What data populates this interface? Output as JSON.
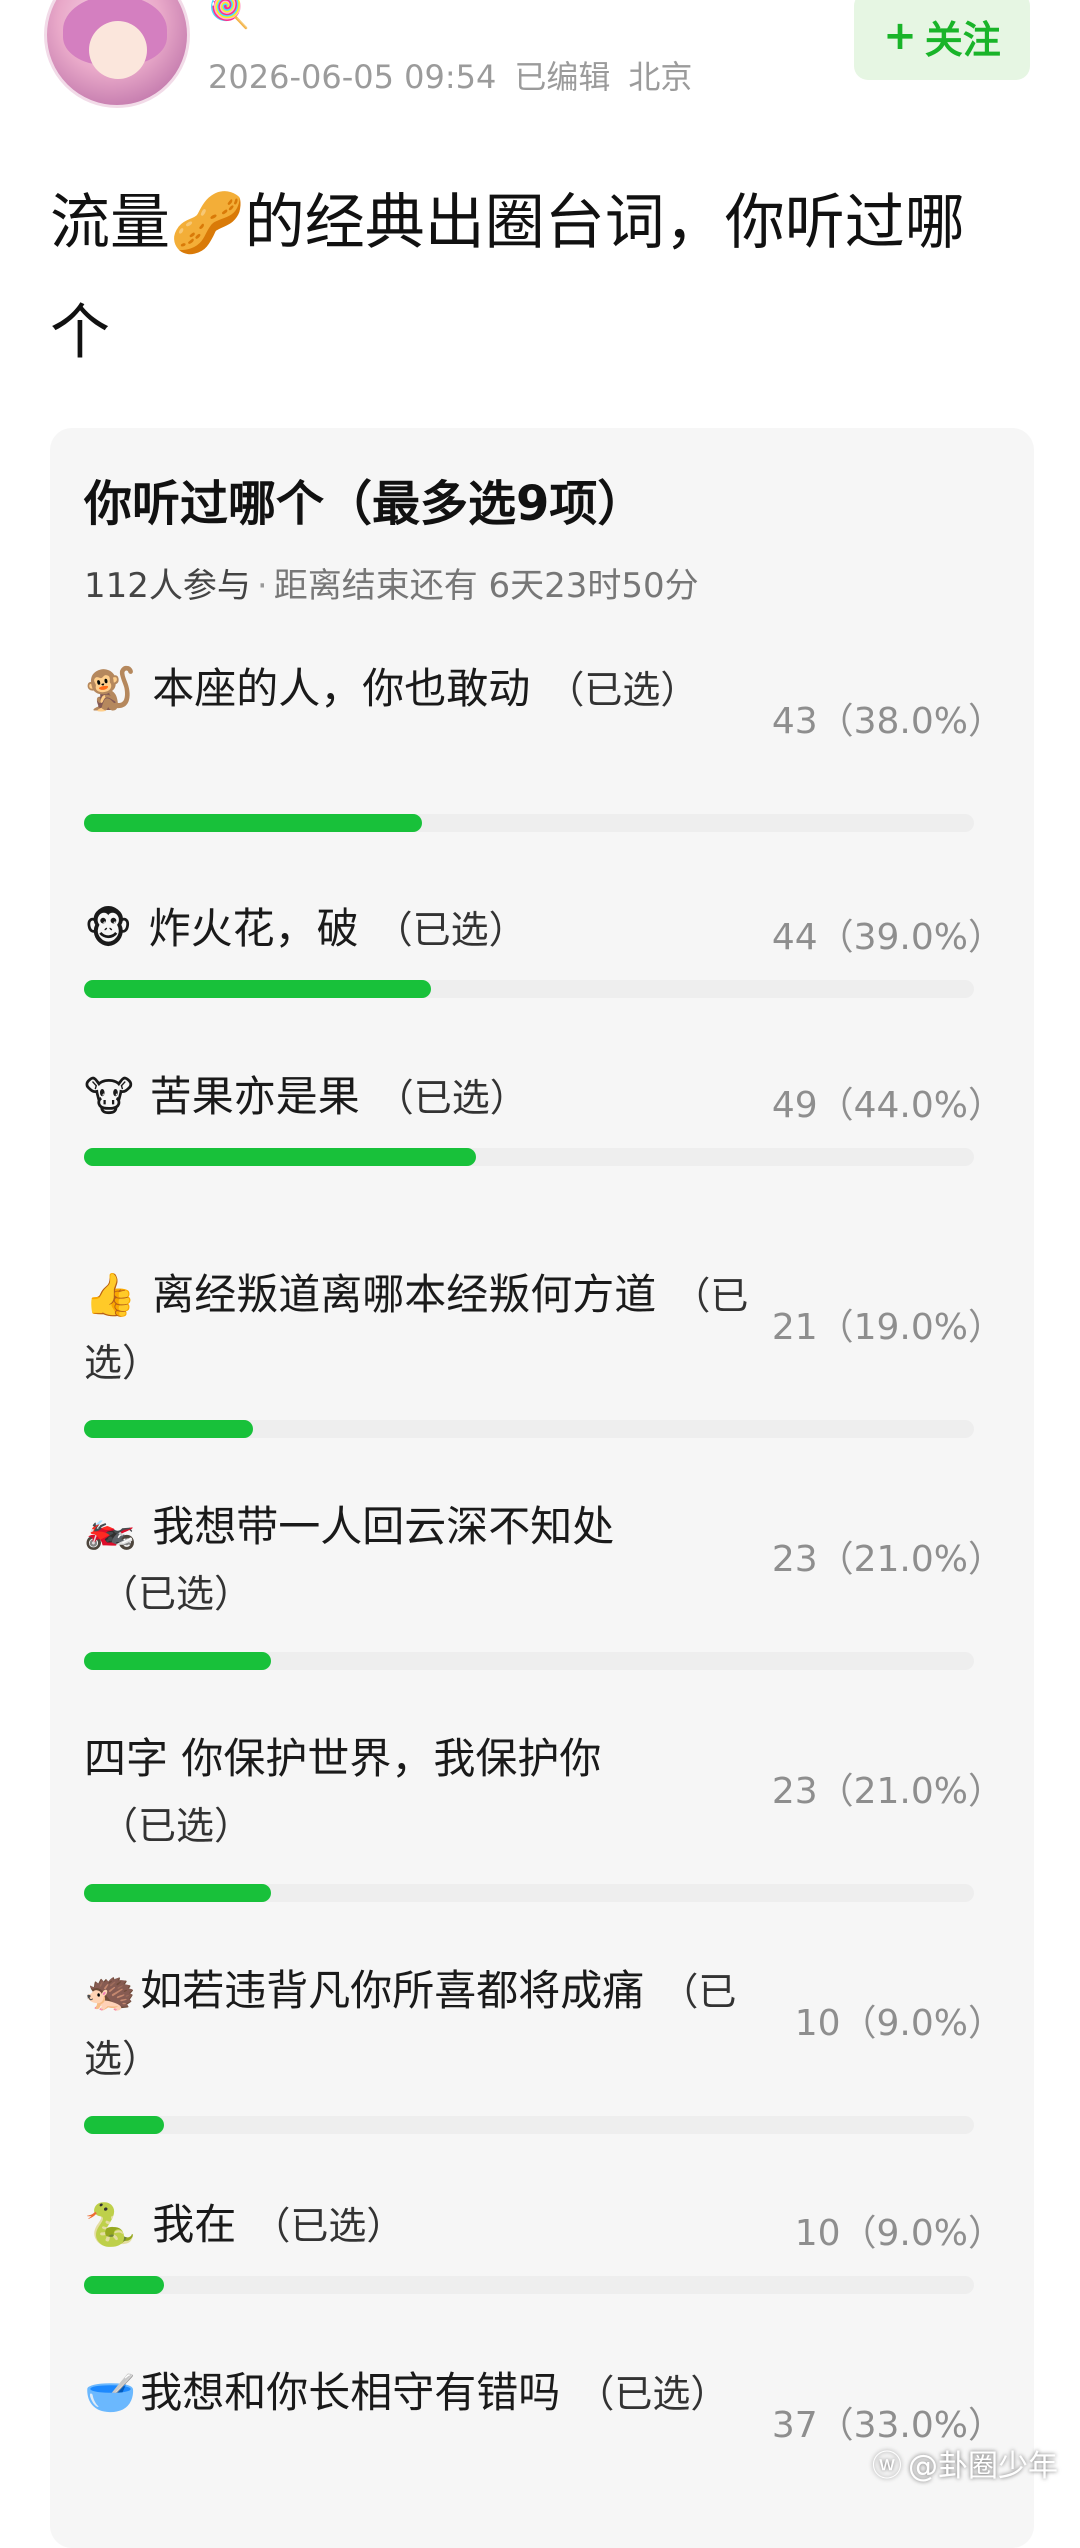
{
  "post": {
    "candy_icon": "🍭",
    "date": "2026-06-05 09:54",
    "edited": "已编辑",
    "location": "北京",
    "follow_plus": "+",
    "follow_label": "关注",
    "title_part1": "流量",
    "title_emoji": "🥜",
    "title_part2": "的经典出圈台词，你听过哪个"
  },
  "poll": {
    "title": "你听过哪个（最多选9项）",
    "participants": "112人参与",
    "separator": "·",
    "remaining": "距离结束还有 6天23时50分",
    "options": [
      {
        "emoji": "🐒",
        "text": "本座的人，你也敢动",
        "selected": "（已选）",
        "stat": "43（38.0%）",
        "percent": 38.0
      },
      {
        "emoji": "🐵",
        "text": "炸火花，破",
        "selected": "（已选）",
        "stat": "44（39.0%）",
        "percent": 39.0
      },
      {
        "emoji": "🐮",
        "text": "苦果亦是果",
        "selected": "（已选）",
        "stat": "49（44.0%）",
        "percent": 44.0
      },
      {
        "emoji": "👍",
        "text": "离经叛道离哪本经叛何方道",
        "selected": "（已选）",
        "stat": "21（19.0%）",
        "percent": 19.0
      },
      {
        "emoji": "🏍️",
        "text": "我想带一人回云深不知处",
        "selected": "（已选）",
        "stat": "23（21.0%）",
        "percent": 21.0
      },
      {
        "emoji": "",
        "text": "四字 你保护世界，我保护你",
        "selected": "（已选）",
        "stat": "23（21.0%）",
        "percent": 21.0
      },
      {
        "emoji": "🦔",
        "text": "如若违背凡你所喜都将成痛",
        "selected": "（已选）",
        "stat": "10（9.0%）",
        "percent": 9.0
      },
      {
        "emoji": "🐍",
        "text": "我在",
        "selected": "（已选）",
        "stat": "10（9.0%）",
        "percent": 9.0
      },
      {
        "emoji": "🥣",
        "text": "我想和你长相守有错吗",
        "selected": "（已选）",
        "stat": "37（33.0%）",
        "percent": 33.0
      }
    ]
  },
  "watermark": {
    "icon": "ⓦ",
    "text": "@卦圈少年"
  },
  "colors": {
    "accent": "#18c13a",
    "follow_bg": "#e6f6e3",
    "follow_text": "#19b429"
  }
}
